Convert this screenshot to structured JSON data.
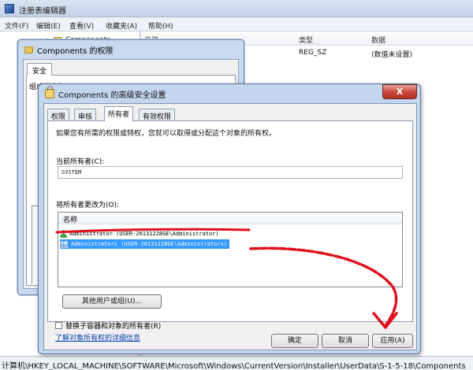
{
  "regedit": {
    "title": "注册表编辑器",
    "menu": [
      "文件(F)",
      "编辑(E)",
      "查看(V)",
      "收藏夹(A)",
      "帮助(H)"
    ],
    "tree_node": "Components",
    "columns": {
      "name": "名称",
      "type": "类型",
      "data": "数据"
    },
    "row": {
      "type": "REG_SZ",
      "data": "(数值未设置)"
    },
    "status_path": "计算机\\HKEY_LOCAL_MACHINE\\SOFTWARE\\Microsoft\\Windows\\CurrentVersion\\Installer\\UserData\\S-1-5-18\\Components"
  },
  "permissions_dialog": {
    "title": "Components 的权限",
    "tab": "安全",
    "group_label": "组或用户名(G):"
  },
  "advanced_dialog": {
    "title": "Components 的高级安全设置",
    "close_label": "X",
    "tabs": [
      "权限",
      "审核",
      "所有者",
      "有效权限"
    ],
    "active_tab": "所有者",
    "description": "如果您有所需的权限或特权，您就可以取得或分配这个对象的所有权。",
    "current_owner_label": "当前所有者(C):",
    "current_owner_value": "SYSTEM",
    "change_owner_label": "将所有者更改为(O):",
    "list_header": "名称",
    "owners": [
      "Administrator (USER-20131228GE\\Administrator)",
      "Administrators (USER-20131228GE\\Administrators)"
    ],
    "selected_owner_index": 1,
    "other_users_button": "其他用户或组(U)...",
    "replace_checkbox_label": "替换子容器和对象的所有者(R)",
    "replace_checked": false,
    "learn_more_link": "了解对象所有权的详细信息",
    "buttons": {
      "ok": "确定",
      "cancel": "取消",
      "apply": "应用(A)"
    }
  },
  "colors": {
    "annotation": "#e0101d",
    "selection": "#3399ff",
    "close": "#c84536"
  }
}
